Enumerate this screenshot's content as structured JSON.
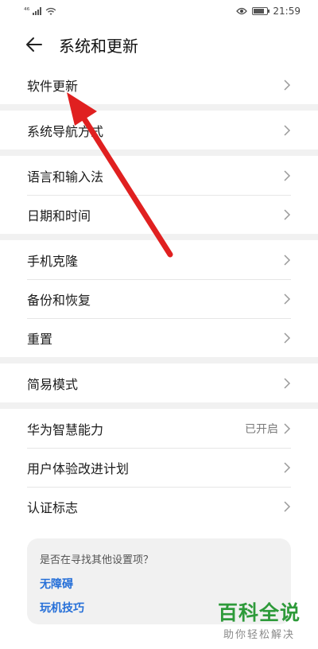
{
  "status_bar": {
    "left_signal": "⁴⁶",
    "time": "21:59"
  },
  "header": {
    "title": "系统和更新"
  },
  "groups": [
    {
      "items": [
        {
          "label": "软件更新"
        }
      ]
    },
    {
      "items": [
        {
          "label": "系统导航方式"
        }
      ]
    },
    {
      "items": [
        {
          "label": "语言和输入法"
        },
        {
          "label": "日期和时间"
        }
      ]
    },
    {
      "items": [
        {
          "label": "手机克隆"
        },
        {
          "label": "备份和恢复"
        },
        {
          "label": "重置"
        }
      ]
    },
    {
      "items": [
        {
          "label": "简易模式"
        }
      ]
    },
    {
      "items": [
        {
          "label": "华为智慧能力",
          "value": "已开启"
        },
        {
          "label": "用户体验改进计划"
        },
        {
          "label": "认证标志"
        }
      ]
    }
  ],
  "suggest": {
    "title": "是否在寻找其他设置项？",
    "links": [
      "无障碍",
      "玩机技巧"
    ]
  },
  "watermark": {
    "main": "百科全说",
    "sub": "助你轻松解决"
  },
  "colors": {
    "link": "#256fd8",
    "annotation_arrow": "#e02020",
    "watermark": "#2e9a3a"
  },
  "icons": {
    "back": "back-arrow-icon",
    "chevron": "chevron-right-icon",
    "eye": "eye-icon",
    "wifi": "wifi-icon",
    "battery": "battery-icon"
  }
}
